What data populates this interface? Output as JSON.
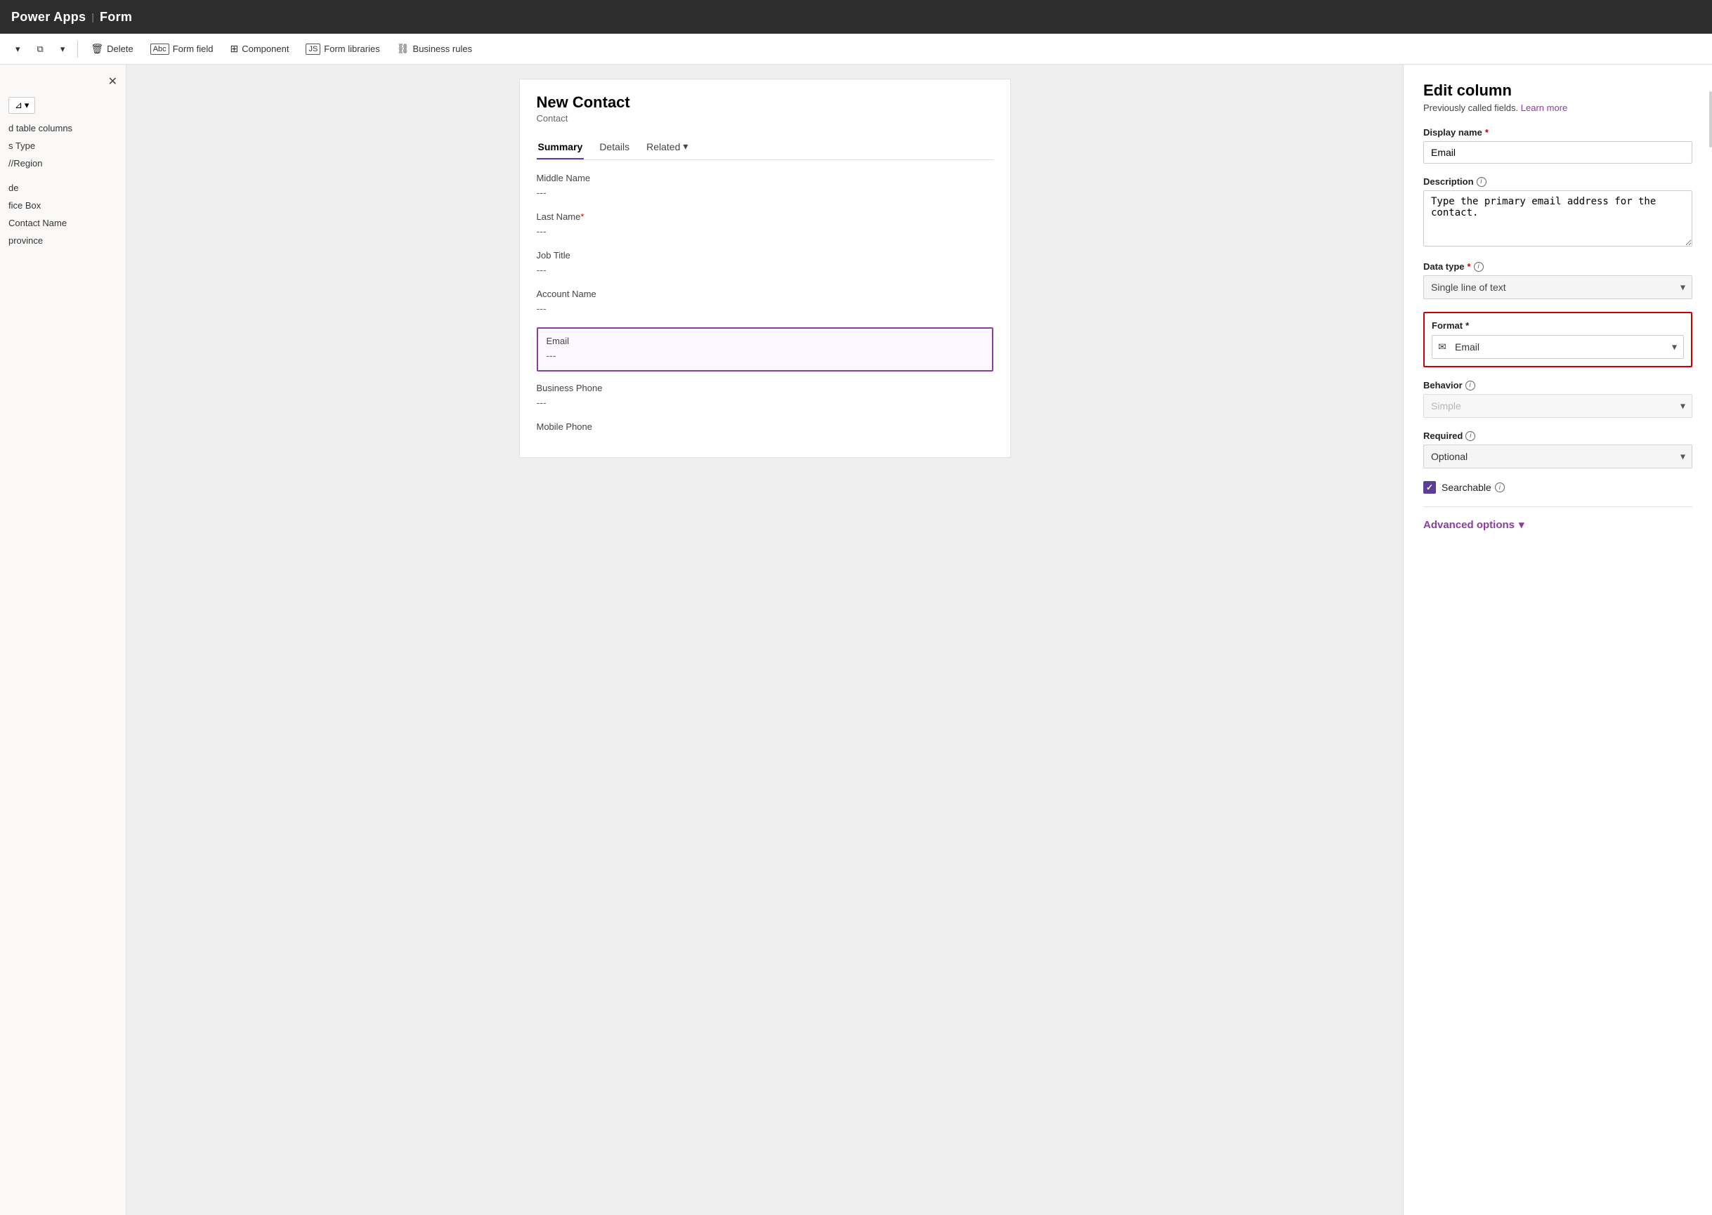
{
  "topbar": {
    "app_name": "Power Apps",
    "separator": "|",
    "page_name": "Form"
  },
  "toolbar": {
    "delete_label": "Delete",
    "form_field_label": "Form field",
    "component_label": "Component",
    "form_libraries_label": "Form libraries",
    "business_rules_label": "Business rules",
    "dropdown_icon": "▾"
  },
  "sidebar": {
    "close_icon": "✕",
    "filter_icon": "⊿",
    "filter_dropdown": "▾",
    "section_label_1": "d table columns",
    "type_label": "s Type",
    "region_label": "//Region",
    "extra1": "",
    "extra2": "de",
    "extra3": "fice Box",
    "extra4": "Contact Name",
    "extra5": "province"
  },
  "form": {
    "title": "New Contact",
    "subtitle": "Contact",
    "tabs": [
      {
        "label": "Summary",
        "active": true
      },
      {
        "label": "Details",
        "active": false
      },
      {
        "label": "Related",
        "active": false,
        "has_dropdown": true
      }
    ],
    "fields": [
      {
        "label": "Middle Name",
        "value": "---",
        "required": false,
        "selected": false
      },
      {
        "label": "Last Name",
        "value": "---",
        "required": true,
        "selected": false
      },
      {
        "label": "Job Title",
        "value": "---",
        "required": false,
        "selected": false
      },
      {
        "label": "Account Name",
        "value": "---",
        "required": false,
        "selected": false
      },
      {
        "label": "Email",
        "value": "---",
        "required": false,
        "selected": true
      },
      {
        "label": "Business Phone",
        "value": "---",
        "required": false,
        "selected": false
      },
      {
        "label": "Mobile Phone",
        "value": "---",
        "required": false,
        "selected": false
      }
    ]
  },
  "panel": {
    "title": "Edit column",
    "subtitle": "Previously called fields.",
    "learn_more": "Learn more",
    "display_name_label": "Display name",
    "display_name_required": true,
    "display_name_value": "Email",
    "description_label": "Description",
    "description_info": true,
    "description_value": "Type the primary email address for the contact.",
    "data_type_label": "Data type",
    "data_type_required": true,
    "data_type_info": true,
    "data_type_icon": "Abc",
    "data_type_value": "Single line of text",
    "format_label": "Format",
    "format_required": true,
    "format_icon": "✉",
    "format_value": "Email",
    "behavior_label": "Behavior",
    "behavior_info": true,
    "behavior_value": "Simple",
    "required_label": "Required",
    "required_info": true,
    "required_value": "Optional",
    "searchable_label": "Searchable",
    "searchable_info": true,
    "searchable_checked": true,
    "advanced_options_label": "Advanced options",
    "advanced_options_icon": "▾"
  }
}
